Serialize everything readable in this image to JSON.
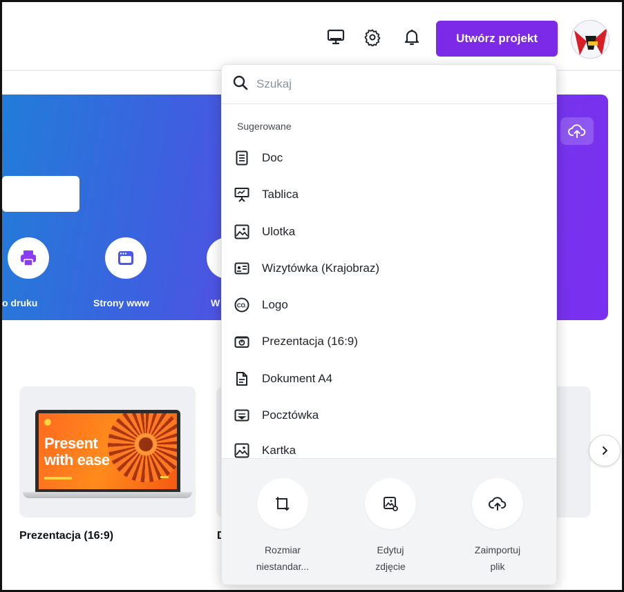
{
  "header": {
    "create_button_label": "Utwórz projekt"
  },
  "banner": {
    "categories": [
      {
        "label": "o druku"
      },
      {
        "label": "Strony www"
      },
      {
        "label": "W"
      }
    ]
  },
  "search": {
    "placeholder": "Szukaj",
    "section_title": "Sugerowane",
    "suggestions": [
      {
        "label": "Doc",
        "icon": "doc-icon"
      },
      {
        "label": "Tablica",
        "icon": "whiteboard-icon"
      },
      {
        "label": "Ulotka",
        "icon": "flyer-icon"
      },
      {
        "label": "Wizytówka (Krajobraz)",
        "icon": "business-card-icon"
      },
      {
        "label": "Logo",
        "icon": "logo-icon"
      },
      {
        "label": "Prezentacja (16:9)",
        "icon": "presentation-icon"
      },
      {
        "label": "Dokument A4",
        "icon": "a4-document-icon"
      },
      {
        "label": "Pocztówka",
        "icon": "postcard-icon"
      },
      {
        "label": "Kartka",
        "icon": "card-icon"
      }
    ],
    "actions": [
      {
        "line1": "Rozmiar",
        "line2": "niestandar...",
        "icon": "custom-size-icon"
      },
      {
        "line1": "Edytuj",
        "line2": "zdjęcie",
        "icon": "edit-photo-icon"
      },
      {
        "line1": "Zaimportuj",
        "line2": "plik",
        "icon": "upload-icon"
      }
    ]
  },
  "cards": [
    {
      "title": "Prezentacja (16:9)",
      "thumb_line1": "Present",
      "thumb_line2": "with ease"
    },
    {
      "title": "D"
    }
  ],
  "colors": {
    "accent": "#7d2ae8",
    "banner_start": "#1f7fd8",
    "banner_end": "#7b2ff0"
  }
}
